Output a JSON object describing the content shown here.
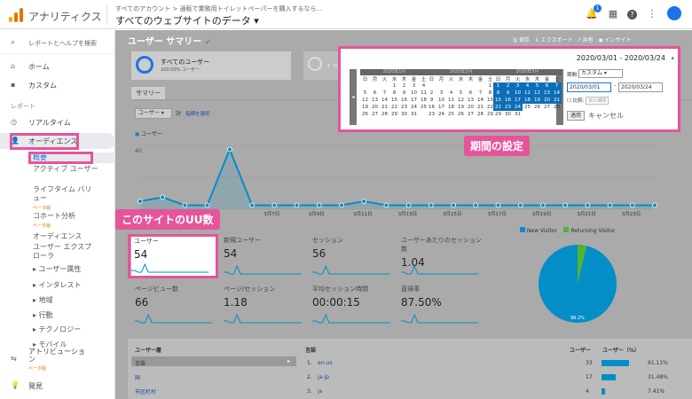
{
  "topbar": {
    "app_name": "アナリティクス",
    "account_path": "すべてのアカウント > 通販で業務用トイレットペーパーを購入するなら...",
    "property": "すべてのウェブサイトのデータ ▾",
    "notification_count": "1"
  },
  "sidebar": {
    "search": "レポートとヘルプを検索",
    "home": "ホーム",
    "custom": "カスタム",
    "report_section": "レポート",
    "realtime": "リアルタイム",
    "audience": "オーディエンス",
    "sub": {
      "overview": "概要",
      "active_users": "アクティブ ユーザー",
      "lifetime_value_1": "ライフタイム バリ",
      "lifetime_value_2": "ュー",
      "beta": "ベータ版",
      "cohort": "コホート分析",
      "audiences": "オーディエンス",
      "user_explorer_1": "ユーザー エクスプ",
      "user_explorer_2": "ローラ",
      "user_attributes": "ユーザー属性",
      "interests": "インタレスト",
      "geo": "地域",
      "behavior": "行動",
      "technology": "テクノロジー",
      "mobile": "モバイル"
    },
    "attribution": "アトリビューショ",
    "attribution_2": "ン",
    "discover": "発見"
  },
  "main": {
    "title": "ユーザー サマリー",
    "actions": {
      "save": "保存",
      "export": "エクスポート",
      "share": "共有",
      "insights": "インサイト"
    },
    "segment": {
      "name": "すべてのユーザー",
      "pct": "100.00% ユーザー",
      "add": "+ セグメントを追加"
    },
    "tab_summary": "サマリー",
    "metric_select": "ユーザー ▾",
    "vs": "対",
    "choose_metric": "指標を選択",
    "legend_users": "ユーザー",
    "y_label": "40",
    "x_dates": [
      "3月7日",
      "3月9日",
      "3月11日",
      "3月13日",
      "3月15日",
      "3月17日",
      "3月19日",
      "3月21日",
      "3月23日"
    ],
    "metrics": [
      {
        "label": "ユーザー",
        "value": "54"
      },
      {
        "label": "新規ユーザー",
        "value": "54"
      },
      {
        "label": "セッション",
        "value": "56"
      },
      {
        "label": "ユーザーあたりのセッション数",
        "value": "1.04"
      },
      {
        "label": "ページビュー数",
        "value": "66"
      },
      {
        "label": "ページ/セッション",
        "value": "1.18"
      },
      {
        "label": "平均セッション時間",
        "value": "00:00:15"
      },
      {
        "label": "直帰率",
        "value": "87.50%"
      }
    ],
    "pie_legend": {
      "new": "New Visitor",
      "returning": "Returning Visitor",
      "new_color": "#058dc7",
      "returning_color": "#50b432",
      "pct_label": "96.2%"
    },
    "bottom": {
      "col1_header": "ユーザー層",
      "rows_left": [
        "言語",
        "国",
        "市区町村"
      ],
      "col2_header": "言語",
      "col3_header": "ユーザー",
      "col4_header": "ユーザー（%）",
      "rows": [
        {
          "n": "1.",
          "lang": "en-us",
          "users": "33",
          "pct": "61.11%",
          "frac": 0.6111
        },
        {
          "n": "2.",
          "lang": "ja-jp",
          "users": "17",
          "pct": "31.48%",
          "frac": 0.3148
        },
        {
          "n": "3.",
          "lang": "ja",
          "users": "4",
          "pct": "7.41%",
          "frac": 0.0741
        }
      ]
    }
  },
  "date_panel": {
    "range": "2020/03/01 - 2020/03/24",
    "period_label": "期間:",
    "period_value": "カスタム",
    "start": "2020/03/01",
    "dash": "-",
    "end": "2020/03/24",
    "compare": "比較:",
    "compare_value": "前の期間",
    "apply": "適用",
    "cancel": "キャンセル",
    "months": [
      "2020年1月",
      "2020年2月",
      "2020年3月"
    ],
    "weekdays": [
      "日",
      "月",
      "火",
      "水",
      "木",
      "金",
      "土"
    ]
  },
  "annotations": {
    "period_setting": "期間の設定",
    "site_uu": "このサイトのUU数"
  },
  "chart_data": {
    "type": "line",
    "series": [
      {
        "name": "ユーザー",
        "values": [
          2,
          3,
          1,
          1,
          15,
          1,
          1,
          1,
          1,
          1,
          2,
          1,
          1,
          1,
          1,
          1,
          1,
          1,
          1,
          1,
          1,
          1,
          1,
          1
        ]
      }
    ],
    "x_labels": [
      "3月7日",
      "3月9日",
      "3月11日",
      "3月13日",
      "3月15日",
      "3月17日",
      "3月19日",
      "3月21日",
      "3月23日"
    ]
  }
}
